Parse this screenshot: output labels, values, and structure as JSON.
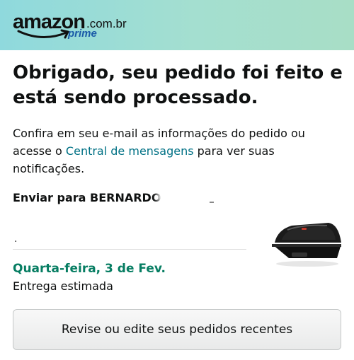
{
  "header": {
    "logo_word": "amazon",
    "logo_domain": ".com.br",
    "logo_prime": "prime"
  },
  "confirmation": {
    "title": "Obrigado, seu pedido foi feito e está sendo processado.",
    "message_before_link": "Confira em seu e-mail as informações do pedido ou acesse o ",
    "message_link": "Central de mensagens",
    "message_after_link": " para ver suas notificações."
  },
  "shipping": {
    "ship_to": "Enviar para BERNARDO",
    "address_partial": "."
  },
  "delivery": {
    "date": "Quarta-feira, 3 de Fev.",
    "label": "Entrega estimada"
  },
  "product": {
    "icon": "sandwich-maker-image"
  },
  "actions": {
    "review_button": "Revise ou edite seus pedidos recentes"
  },
  "colors": {
    "link": "#007185",
    "delivery_green": "#067d62",
    "prime_blue": "#1a5aa8",
    "header_start": "#8fd9dd",
    "header_end": "#a8dec6"
  }
}
